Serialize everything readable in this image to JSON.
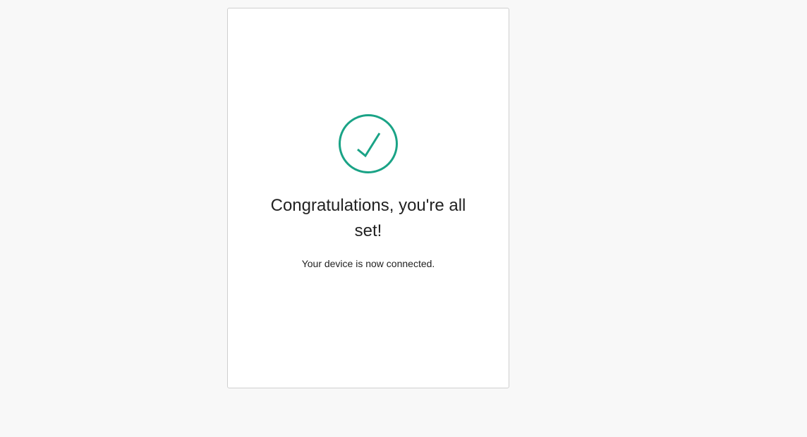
{
  "card": {
    "title": "Congratulations, you're all set!",
    "message": "Your device is now connected.",
    "icon": "check-circle-icon",
    "accent_color": "#1aa386"
  },
  "colors": {
    "background": "#f8f8f8",
    "card_background": "#ffffff",
    "card_border": "#cfcfcf",
    "text": "#222222"
  }
}
